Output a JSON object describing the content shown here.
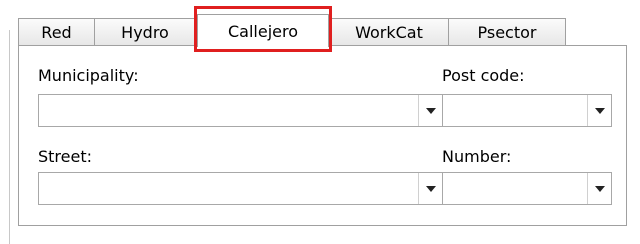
{
  "tabs": [
    {
      "label": "Red"
    },
    {
      "label": "Hydro"
    },
    {
      "label": "Callejero",
      "active": true
    },
    {
      "label": "WorkCat"
    },
    {
      "label": "Psector"
    }
  ],
  "highlight_color": "#e01f1f",
  "form": {
    "municipality": {
      "label": "Municipality:",
      "value": ""
    },
    "post_code": {
      "label": "Post code:",
      "value": ""
    },
    "street": {
      "label": "Street:",
      "value": ""
    },
    "number": {
      "label": "Number:",
      "value": ""
    }
  },
  "icons": {
    "dropdown": "chevron-down-icon"
  }
}
